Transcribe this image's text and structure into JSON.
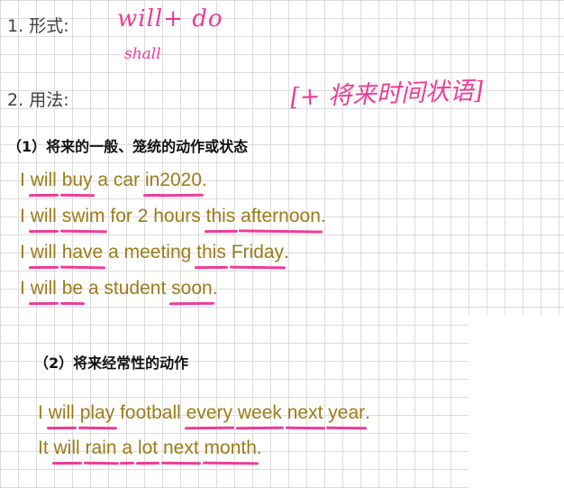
{
  "sections": {
    "form": {
      "number": "1.",
      "title": "形式:",
      "note_line1": "will+ do",
      "note_line2": "shall"
    },
    "usage": {
      "number": "2.",
      "title": "用法:",
      "note": "[+ 将来时间状语]"
    }
  },
  "subsection1": {
    "title": "（1）将来的一般、笼统的动作或状态",
    "examples": [
      [
        "I",
        "will",
        "buy",
        "a car",
        "in",
        "2020",
        "."
      ],
      [
        "I",
        "will",
        "swim",
        "for 2 hours",
        "this",
        "afternoon",
        "."
      ],
      [
        "I",
        "will",
        "have",
        "a meeting",
        "this",
        "Friday",
        "."
      ],
      [
        "I",
        "will",
        "be",
        "a student",
        "soon",
        "."
      ]
    ]
  },
  "subsection2": {
    "title": "（2）将来经常性的动作",
    "examples": [
      [
        "I",
        "will",
        "play",
        "football",
        "every",
        "week",
        "next",
        "year",
        "."
      ],
      [
        "It",
        "will",
        "rain",
        "a",
        "lot",
        "next",
        "month",
        "."
      ]
    ]
  },
  "colors": {
    "handwriting": "#ee3c96",
    "example_text": "#9c7b18",
    "grid": "#dcdcdc"
  }
}
